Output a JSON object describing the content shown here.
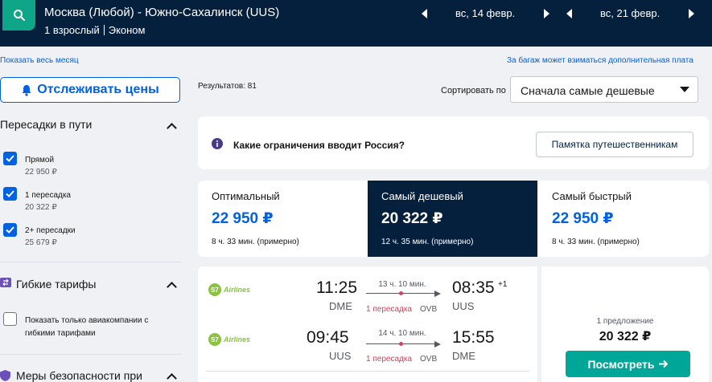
{
  "header": {
    "route": "Москва (Любой) - Южно-Сахалинск (UUS)",
    "passengers": "1 взрослый",
    "cabin": "Эконом",
    "depart_date": "вс, 14 февр.",
    "return_date": "вс, 21 февр."
  },
  "links": {
    "show_month": "Показать весь месяц",
    "baggage_note": "За багаж может взиматься дополнительная плата"
  },
  "sidebar": {
    "track_label": "Отслеживать цены",
    "stops_title": "Пересадки в пути",
    "stops": [
      {
        "label": "Прямой",
        "price": "22 950 ₽",
        "checked": true
      },
      {
        "label": "1 пересадка",
        "price": "20 322 ₽",
        "checked": true
      },
      {
        "label": "2+ пересадки",
        "price": "25 679 ₽",
        "checked": true
      }
    ],
    "flex_title": "Гибкие тарифы",
    "flex_option_line1": "Показать только авиакомпании с",
    "flex_option_line2": "гибкими тарифами",
    "safety_title": "Меры безопасности при"
  },
  "results": {
    "count": "Результатов: 81",
    "sort_label": "Сортировать по",
    "sort_value": "Сначала самые дешевые"
  },
  "info": {
    "question": "Какие ограничения вводит Россия?",
    "memo_button": "Памятка путешественникам"
  },
  "tabs": [
    {
      "name": "Оптимальный",
      "price": "22 950 ₽",
      "duration": "8 ч. 33 мин. (примерно)",
      "active": false
    },
    {
      "name": "Самый дешевый",
      "price": "20 322 ₽",
      "duration": "12 ч. 35 мин. (примерно)",
      "active": true
    },
    {
      "name": "Самый быстрый",
      "price": "22 950 ₽",
      "duration": "8 ч. 33 мин. (примерно)",
      "active": false
    }
  ],
  "flight": {
    "outbound": {
      "airline": "Airlines",
      "dep_time": "11:25",
      "dep_code": "DME",
      "duration": "13 ч. 10 мин.",
      "stops": "1 пересадка",
      "stop_code": "OVB",
      "arr_time": "08:35",
      "arr_day_offset": "+1",
      "arr_code": "UUS"
    },
    "inbound": {
      "airline": "Airlines",
      "dep_time": "09:45",
      "dep_code": "UUS",
      "duration": "14 ч. 10 мин.",
      "stops": "1 пересадка",
      "stop_code": "OVB",
      "arr_time": "15:55",
      "arr_code": "DME"
    },
    "offers": "1 предложение",
    "price": "20 322 ₽",
    "view_button": "Посмотреть"
  },
  "colors": {
    "header_bg": "#05203c",
    "accent_blue": "#0062e3",
    "search_green": "#0fa589",
    "cta_teal": "#00a698",
    "stop_red": "#d1435b",
    "s7_green": "#8ac33f"
  }
}
